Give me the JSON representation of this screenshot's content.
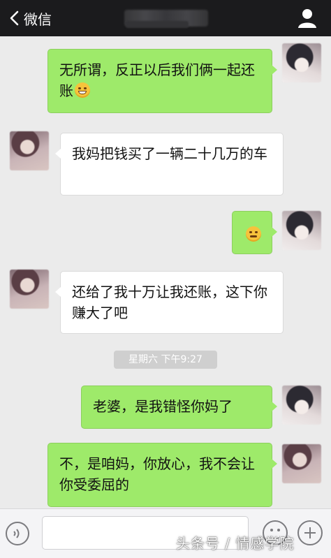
{
  "header": {
    "back_label": "微信"
  },
  "messages": [
    {
      "side": "right",
      "text": "无所谓，反正以后我们俩一起还账",
      "emoji": "grin-emoji"
    },
    {
      "side": "left",
      "text": "我妈把钱买了一辆二十几万的车"
    },
    {
      "side": "right",
      "emoji": "angry-emoji"
    },
    {
      "side": "left",
      "text": "还给了我十万让我还账，这下你赚大了吧"
    },
    {
      "side": "right",
      "text": "老婆，是我错怪你妈了"
    },
    {
      "side": "left",
      "text": "不，是咱妈，你放心，我不会让你受委屈的"
    }
  ],
  "timestamp": "星期六 下午9:27",
  "input": {
    "value": "",
    "placeholder": ""
  },
  "watermark": "头条号 / 情感学院",
  "icons": [
    "back-chevron-icon",
    "profile-icon",
    "voice-icon",
    "emoji-icon",
    "plus-icon"
  ]
}
